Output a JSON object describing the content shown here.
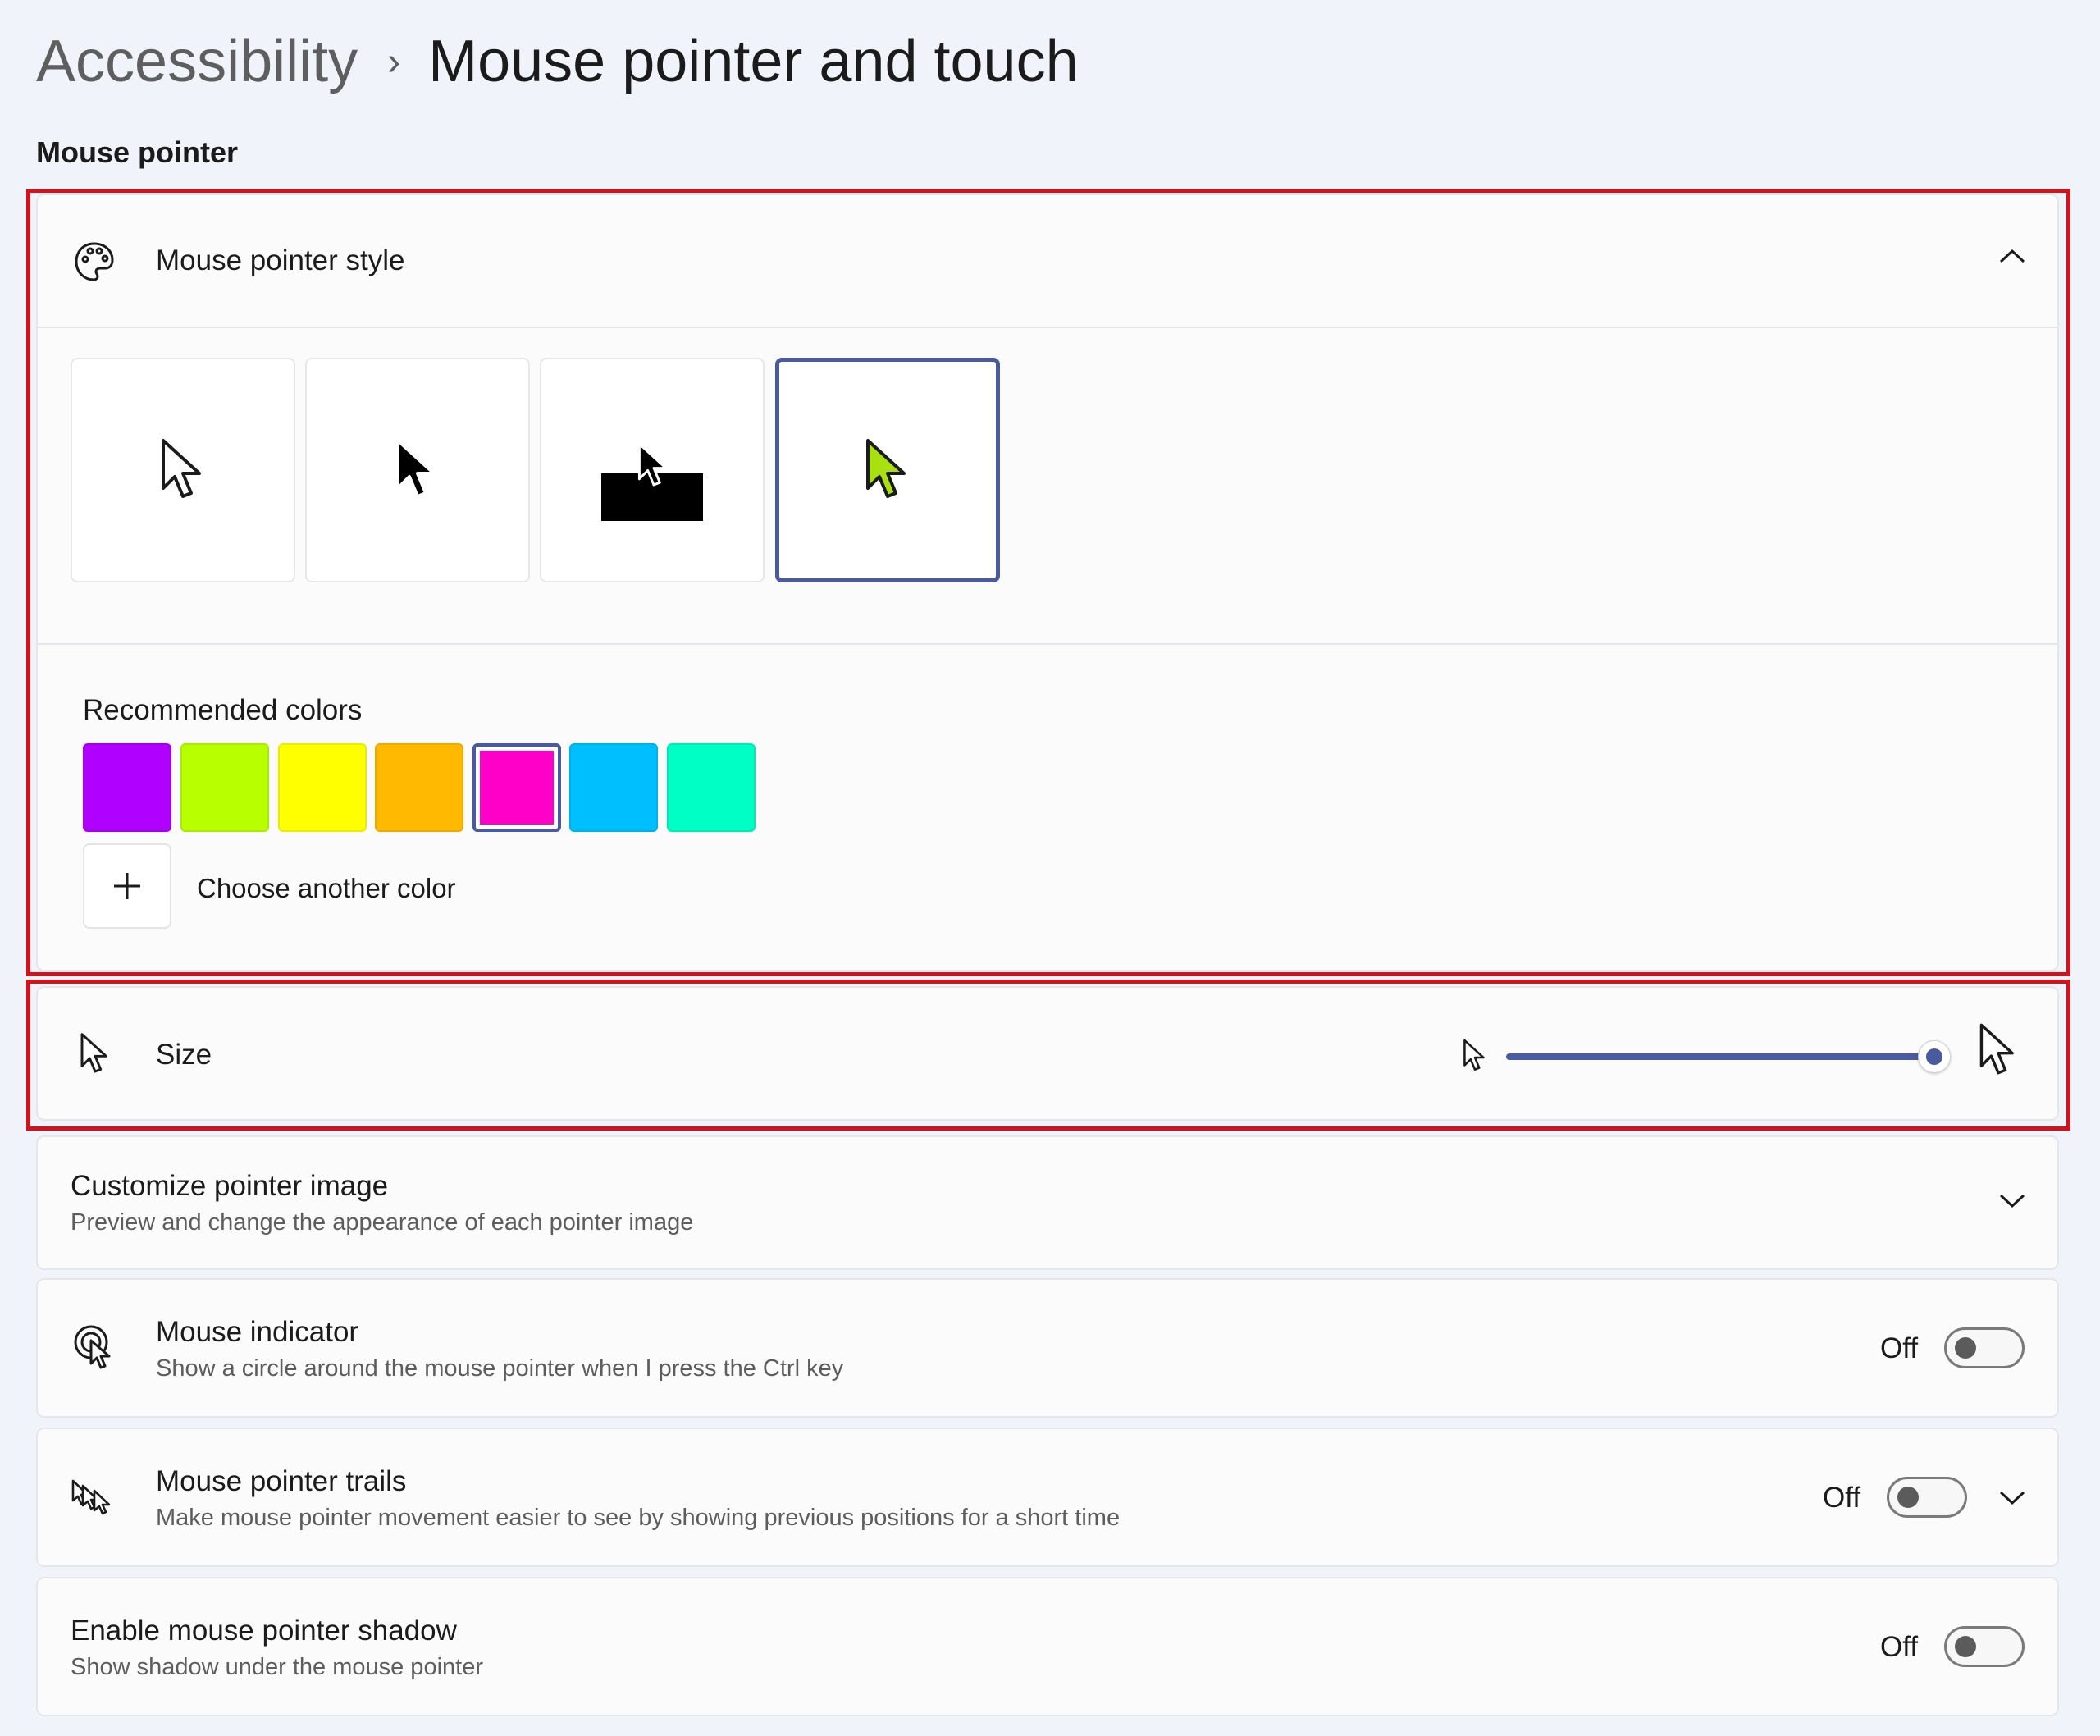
{
  "breadcrumb": {
    "parent": "Accessibility",
    "separator": "›",
    "current": "Mouse pointer and touch"
  },
  "section_label": "Mouse pointer",
  "pointer_style": {
    "title": "Mouse pointer style",
    "icon": "palette-icon",
    "styles": [
      {
        "name": "white",
        "icon": "white-pointer-icon"
      },
      {
        "name": "black",
        "icon": "black-pointer-icon"
      },
      {
        "name": "inverted",
        "icon": "inverted-pointer-icon"
      },
      {
        "name": "custom",
        "icon": "custom-color-pointer-icon",
        "selected": true
      }
    ],
    "recommended_label": "Recommended colors",
    "colors": [
      "#b000ff",
      "#b8ff00",
      "#ffff00",
      "#ffba00",
      "#ff00c8",
      "#00bfff",
      "#00ffc4"
    ],
    "selected_color": "#ff00c8",
    "choose_color_label": "Choose another color",
    "accent": "#4a5aa0",
    "custom_pointer_color": "#a8e010"
  },
  "size": {
    "title": "Size",
    "icon": "pointer-icon",
    "slider_value": 1.0
  },
  "customize": {
    "title": "Customize pointer image",
    "subtitle": "Preview and change the appearance of each pointer image"
  },
  "indicator": {
    "title": "Mouse indicator",
    "subtitle": "Show a circle around the mouse pointer when I press the Ctrl key",
    "state": "Off",
    "icon": "mouse-indicator-icon"
  },
  "trails": {
    "title": "Mouse pointer trails",
    "subtitle": "Make mouse pointer movement easier to see by showing previous positions for a short time",
    "state": "Off",
    "icon": "pointer-trails-icon"
  },
  "shadow": {
    "title": "Enable mouse pointer shadow",
    "subtitle": "Show shadow under the mouse pointer",
    "state": "Off"
  }
}
